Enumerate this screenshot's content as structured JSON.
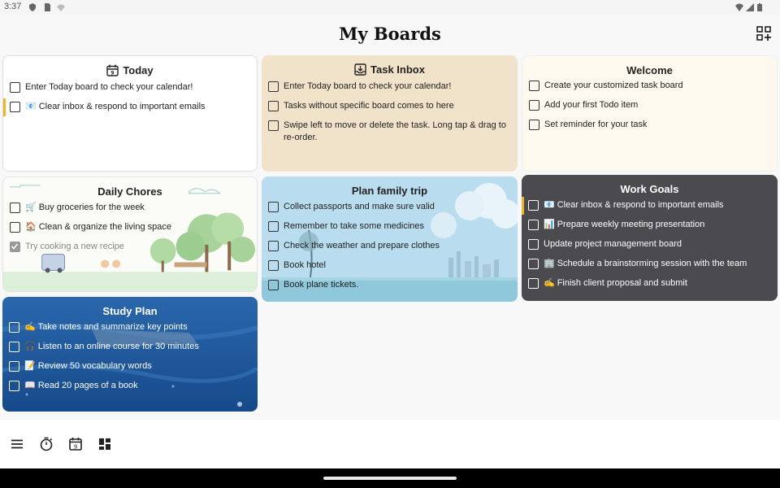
{
  "status_bar": {
    "time": "3:37"
  },
  "header": {
    "title": "My Boards"
  },
  "boards": [
    {
      "title": "Today",
      "icon": "calendar-icon",
      "background": "#ffffff",
      "tasks": [
        {
          "text": "Enter Today board to check your calendar!",
          "emoji": "",
          "done": false,
          "flagged": false
        },
        {
          "text": "Clear inbox & respond to important emails",
          "emoji": "📧",
          "done": false,
          "flagged": true
        }
      ]
    },
    {
      "title": "Task Inbox",
      "icon": "inbox-icon",
      "background": "#f1e2ca",
      "tasks": [
        {
          "text": "Enter Today board to check your calendar!",
          "emoji": "",
          "done": false,
          "flagged": false
        },
        {
          "text": "Tasks without specific board comes to here",
          "emoji": "",
          "done": false,
          "flagged": false
        },
        {
          "text": "Swipe left to move or delete the task. Long tap & drag to re-order.",
          "emoji": "",
          "done": false,
          "flagged": false
        }
      ]
    },
    {
      "title": "Welcome",
      "icon": "",
      "background": "#fdf9ee",
      "tasks": [
        {
          "text": "Create your customized task board",
          "emoji": "",
          "done": false,
          "flagged": false
        },
        {
          "text": "Add your first Todo item",
          "emoji": "",
          "done": false,
          "flagged": false
        },
        {
          "text": "Set reminder for your task",
          "emoji": "",
          "done": false,
          "flagged": false
        }
      ]
    },
    {
      "title": "Daily Chores",
      "icon": "",
      "background": "#fbfbf7",
      "tasks": [
        {
          "text": "Buy groceries for the week",
          "emoji": "🛒",
          "done": false,
          "flagged": false
        },
        {
          "text": "Clean & organize the living space",
          "emoji": "🏠",
          "done": false,
          "flagged": false
        },
        {
          "text": "Try cooking a new recipe",
          "emoji": "",
          "done": true,
          "flagged": false
        }
      ]
    },
    {
      "title": "Plan family trip",
      "icon": "",
      "background": "#b9dcee",
      "tasks": [
        {
          "text": "Collect passports and make sure valid",
          "emoji": "",
          "done": false,
          "flagged": false
        },
        {
          "text": "Remember to take some medicines",
          "emoji": "",
          "done": false,
          "flagged": false
        },
        {
          "text": "Check the weather and prepare clothes",
          "emoji": "",
          "done": false,
          "flagged": false
        },
        {
          "text": "Book hotel",
          "emoji": "",
          "done": false,
          "flagged": false
        },
        {
          "text": "Book plane tickets.",
          "emoji": "",
          "done": false,
          "flagged": false
        }
      ]
    },
    {
      "title": "Work Goals",
      "icon": "",
      "background": "#4a4a4f",
      "tasks": [
        {
          "text": "Clear inbox & respond to important emails",
          "emoji": "📧",
          "done": false,
          "flagged": true
        },
        {
          "text": "Prepare weekly meeting presentation",
          "emoji": "📊",
          "done": false,
          "flagged": false
        },
        {
          "text": "Update project management board",
          "emoji": "",
          "done": false,
          "flagged": false
        },
        {
          "text": "Schedule a brainstorming session with the team",
          "emoji": "🏢",
          "done": false,
          "flagged": false
        },
        {
          "text": "Finish client proposal and submit",
          "emoji": "✍️",
          "done": false,
          "flagged": false
        }
      ]
    },
    {
      "title": "Study Plan",
      "icon": "",
      "background": "#1f5aa0",
      "tasks": [
        {
          "text": "Take notes and summarize key points",
          "emoji": "✍️",
          "done": false,
          "flagged": false
        },
        {
          "text": "Listen to an online course for 30 minutes",
          "emoji": "🎧",
          "done": false,
          "flagged": false
        },
        {
          "text": "Review 50 vocabulary words",
          "emoji": "📝",
          "done": false,
          "flagged": false
        },
        {
          "text": "Read 20 pages of a book",
          "emoji": "📖",
          "done": false,
          "flagged": false
        }
      ]
    }
  ],
  "bottom_nav": [
    {
      "icon": "menu-icon"
    },
    {
      "icon": "timer-icon"
    },
    {
      "icon": "calendar-icon"
    },
    {
      "icon": "boards-icon"
    }
  ],
  "colors": {
    "flag": "#f0b429",
    "accent_dark": "#4a4a4f",
    "accent_blue": "#1f5aa0"
  }
}
